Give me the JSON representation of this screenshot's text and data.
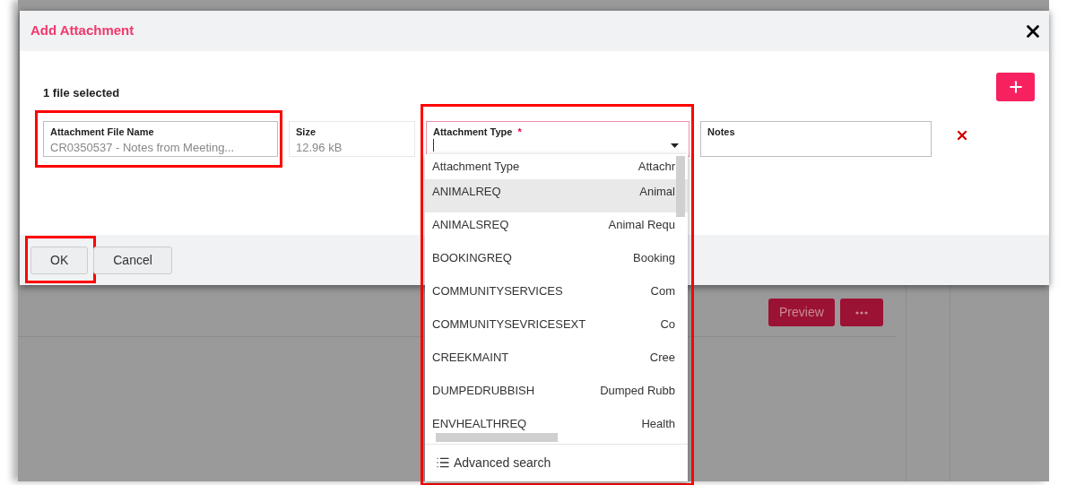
{
  "dialog": {
    "title": "Add Attachment",
    "selected_count": "1 file selected",
    "fields": [
      {
        "kind": "text",
        "label": "Attachment File Name",
        "value": "CR0350537 - Notes from Meeting...",
        "highlighted": true
      },
      {
        "kind": "text",
        "label": "Size",
        "value": "12.96 kB",
        "highlighted": false
      },
      {
        "kind": "select",
        "label": "Attachment Type",
        "required_mark": "*",
        "highlighted": true
      },
      {
        "kind": "text",
        "label": "Notes",
        "highlighted": false
      }
    ],
    "buttons": [
      {
        "label": "OK",
        "highlighted": true
      },
      {
        "label": "Cancel",
        "highlighted": false
      }
    ]
  },
  "dropdown": {
    "columns": [
      "Attachment Type",
      "Attachr"
    ],
    "options": [
      {
        "code": "ANIMALREQ",
        "description": "Animal",
        "selected": true
      },
      {
        "code": "ANIMALSREQ",
        "description": "Animal Requ",
        "selected": false
      },
      {
        "code": "BOOKINGREQ",
        "description": "Booking",
        "selected": false
      },
      {
        "code": "COMMUNITYSERVICES",
        "description": "Com",
        "selected": false
      },
      {
        "code": "COMMUNITYSEVRICESEXT",
        "description": "Co",
        "selected": false
      },
      {
        "code": "CREEKMAINT",
        "description": "Cree",
        "selected": false
      },
      {
        "code": "DUMPEDRUBBISH",
        "description": "Dumped Rubb",
        "selected": false
      },
      {
        "code": "ENVHEALTHREQ",
        "description": "Health",
        "selected": false
      }
    ],
    "footer": "Advanced search"
  },
  "background": {
    "button": "Preview"
  }
}
